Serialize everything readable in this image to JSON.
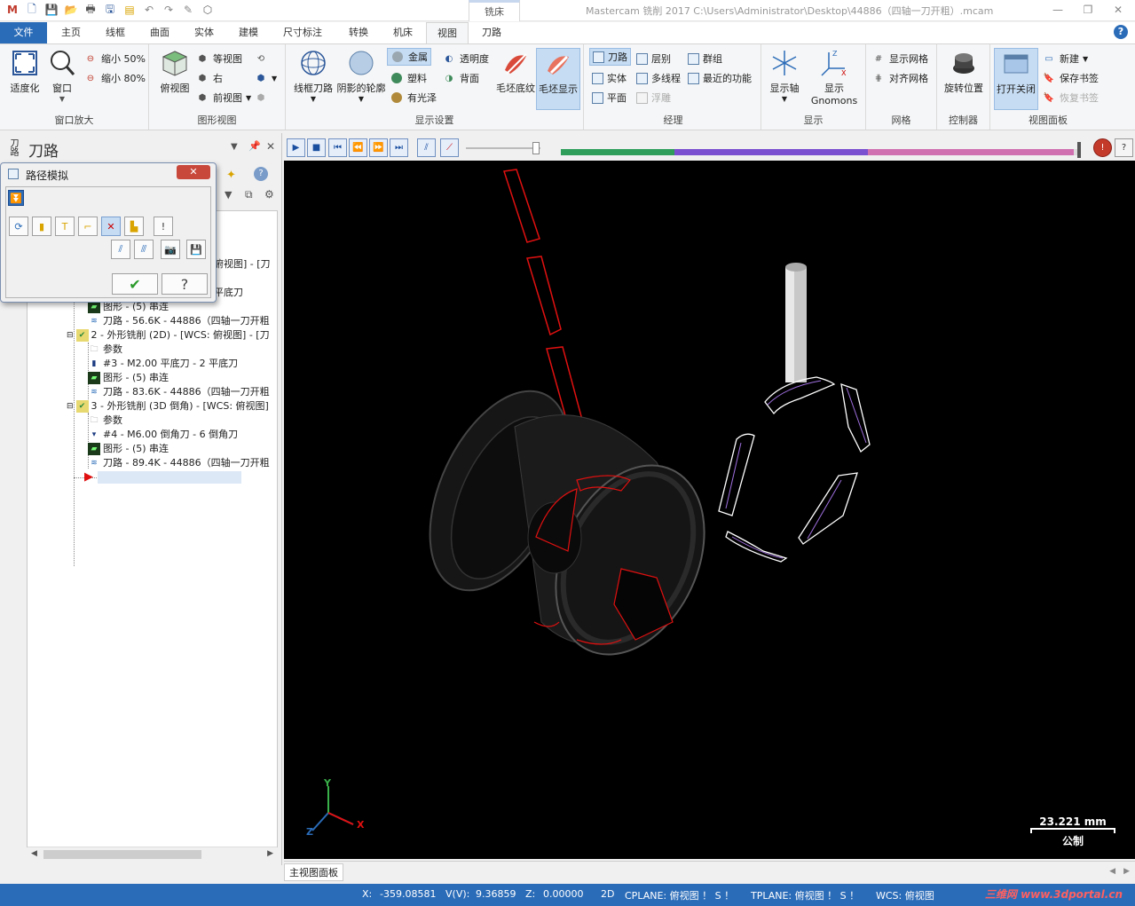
{
  "window": {
    "title": "Mastercam 铣削 2017  C:\\Users\\Administrator\\Desktop\\44886（四轴一刀开粗）.mcam",
    "context_tab": "铣床",
    "minimize": "—",
    "restore": "❐",
    "close": "✕"
  },
  "ribbon_tabs": [
    {
      "label": "文件"
    },
    {
      "label": "主页"
    },
    {
      "label": "线框"
    },
    {
      "label": "曲面"
    },
    {
      "label": "实体"
    },
    {
      "label": "建模"
    },
    {
      "label": "尺寸标注"
    },
    {
      "label": "转换"
    },
    {
      "label": "机床"
    },
    {
      "label": "视图"
    },
    {
      "label": "刀路"
    }
  ],
  "help": "?",
  "ribbon": {
    "zoom_group": {
      "label": "窗口放大",
      "fit": "适度化",
      "window": "窗口",
      "shrink50": "缩小 50%",
      "shrink80": "缩小 80%"
    },
    "view_group": {
      "label": "图形视图",
      "top": "俯视图",
      "iso": "等视图",
      "right": "右",
      "front": "前视图"
    },
    "display_group": {
      "label": "显示设置",
      "wire": "线框刀路",
      "shade": "阴影的轮廓",
      "metal": "金属",
      "plastic": "塑料",
      "gloss": "有光泽",
      "transp": "透明度",
      "back": "背面",
      "stock_tex": "毛坯底纹",
      "stock_show": "毛坯显示"
    },
    "manager_group": {
      "label": "经理",
      "toolpath": "刀路",
      "solid": "实体",
      "plane": "平面",
      "level": "层别",
      "multi": "多线程",
      "float": "浮雕",
      "group": "群组",
      "recent": "最近的功能"
    },
    "show_group": {
      "label": "显示",
      "axes": "显示轴",
      "gnomons": "显示",
      "gnomons2": "Gnomons"
    },
    "grid_group": {
      "label": "网格",
      "showgrid": "显示网格",
      "snapgrid": "对齐网格"
    },
    "ctrl_group": {
      "label": "控制器",
      "rotate": "旋转位置"
    },
    "panel_group": {
      "label": "视图面板",
      "open": "打开关闭",
      "new": "新建",
      "save": "保存书签",
      "restore": "恢复书签"
    }
  },
  "left_panel": {
    "title": "刀路",
    "tab": "刀路",
    "tree": [
      {
        "text": "俯视图] - [刀",
        "indent": 2
      },
      {
        "text": "平底刀",
        "indent": 2
      },
      {
        "text": "图形 - (5) 串连",
        "indent": 3
      },
      {
        "text": "刀路 - 56.6K - 44886（四轴一刀开粗",
        "indent": 3
      },
      {
        "text": "2 - 外形铣削 (2D) - [WCS: 俯视图] - [刀",
        "indent": 2
      },
      {
        "text": "参数",
        "indent": 3
      },
      {
        "text": "#3 - M2.00 平底刀 - 2 平底刀",
        "indent": 3
      },
      {
        "text": "图形 - (5) 串连",
        "indent": 3
      },
      {
        "text": "刀路 - 83.6K - 44886（四轴一刀开粗",
        "indent": 3
      },
      {
        "text": "3 - 外形铣削 (3D 倒角) - [WCS: 俯视图]",
        "indent": 2
      },
      {
        "text": "参数",
        "indent": 3
      },
      {
        "text": "#4 - M6.00 倒角刀 - 6 倒角刀",
        "indent": 3
      },
      {
        "text": "图形 - (5) 串连",
        "indent": 3
      },
      {
        "text": "刀路 - 89.4K - 44886（四轴一刀开粗",
        "indent": 3
      }
    ]
  },
  "dialog": {
    "title": "路径模拟",
    "close": "✕",
    "ok": "✔",
    "help": "?"
  },
  "viewport": {
    "scale_value": "23.221 mm",
    "scale_unit": "公制",
    "axis_x": "X",
    "axis_y": "Y",
    "axis_z": "Z"
  },
  "bottom_tab": "主视图面板",
  "status": {
    "x_label": "X:",
    "x_value": "-359.08581",
    "y_label": "V(V):",
    "y_value": "9.36859",
    "z_label": "Z:",
    "z_value": "0.00000",
    "mode": "2D",
    "cplane": "CPLANE: 俯视图 ！ S ！",
    "tplane": "TPLANE: 俯视图 ！ S ！",
    "wcs": "WCS: 俯视图",
    "watermark": "三维网 www.3dportal.cn"
  },
  "colors": {
    "accent": "#2b6cb8",
    "progress_green": "#2e9e5a",
    "progress_purple": "#7a4fd0",
    "progress_pink": "#d070b0",
    "toolpath_red": "#e01010"
  }
}
